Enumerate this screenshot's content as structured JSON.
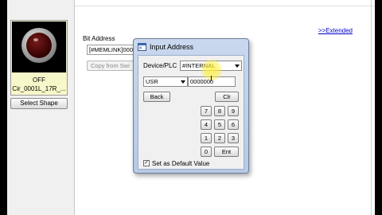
{
  "left_panel": {
    "state": "OFF",
    "shape_name": "Cir_0001L_17R_...",
    "select_shape_label": "Select Shape"
  },
  "content": {
    "extended_link": ">>Extended",
    "bit_address_label": "Bit Address",
    "bit_address_value": "[#MEMLINK]000",
    "copy_label": "Copy from Swi"
  },
  "dialog": {
    "title": "Input Address",
    "device_label": "Device/PLC",
    "device_value": "#INTERNAL",
    "area_value": "USR",
    "address_value": "0000000",
    "back_label": "Back",
    "clr_label": "Clr",
    "keys": [
      "7",
      "8",
      "9",
      "4",
      "5",
      "6",
      "1",
      "2",
      "3",
      "0",
      "Ent"
    ],
    "default_label": "Set as Default Value",
    "default_checked": true
  },
  "icons": {
    "dialog_icon": "app-window-icon",
    "cursor": "text-cursor-icon"
  },
  "colors": {
    "dialog_title_bar": "#c9d8ee",
    "link": "#0000cc",
    "highlight": "#fff03c"
  }
}
